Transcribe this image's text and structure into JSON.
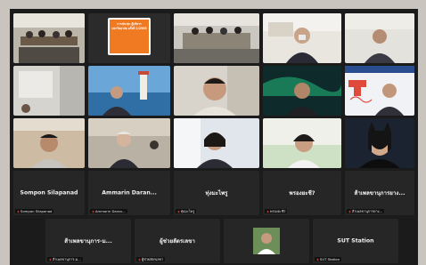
{
  "participants": [
    {
      "id": "r1c1",
      "caption": "",
      "center_name": ""
    },
    {
      "id": "r1c2",
      "caption": "",
      "center_name": "",
      "logo_text": "การประชุม ผู้บริหาร มหาวิทยาลัย ครั้งที่ 2/2565"
    },
    {
      "id": "r1c3",
      "caption": "",
      "center_name": ""
    },
    {
      "id": "r1c4",
      "caption": "",
      "center_name": ""
    },
    {
      "id": "r1c5",
      "caption": "",
      "center_name": ""
    },
    {
      "id": "r2c1",
      "caption": "",
      "center_name": ""
    },
    {
      "id": "r2c2",
      "caption": "",
      "center_name": ""
    },
    {
      "id": "r2c3",
      "caption": "",
      "center_name": ""
    },
    {
      "id": "r2c4",
      "caption": "",
      "center_name": ""
    },
    {
      "id": "r2c5",
      "caption": "",
      "center_name": ""
    },
    {
      "id": "r3c1",
      "caption": "",
      "center_name": ""
    },
    {
      "id": "r3c2",
      "caption": "",
      "center_name": ""
    },
    {
      "id": "r3c3",
      "caption": "",
      "center_name": ""
    },
    {
      "id": "r3c4",
      "caption": "",
      "center_name": ""
    },
    {
      "id": "r3c5",
      "caption": "",
      "center_name": ""
    },
    {
      "id": "r4c1",
      "caption": "Sompon Silapanad",
      "center_name": "Sompon Silapanad"
    },
    {
      "id": "r4c2",
      "caption": "Ammarin Daran...",
      "center_name": "Ammarin Daran..."
    },
    {
      "id": "r4c3",
      "caption": "ทุ่งมะไพรู",
      "center_name": "ทุ่งมะไพรู"
    },
    {
      "id": "r4c4",
      "caption": "พรองยะชี?",
      "center_name": "พรองยะชี?"
    },
    {
      "id": "r4c5",
      "caption": "ส้าเพลขานุการยาง...",
      "center_name": "ส้าเพลขานุการยาง..."
    },
    {
      "id": "r5c1",
      "caption": "ส้าเพลขานุการ-ม...",
      "center_name": "ส้าเพลขานุการ-ม..."
    },
    {
      "id": "r5c2",
      "caption": "ผู้ช่วยลัตรเลขา",
      "center_name": "ผู้ช่วยลัตรเลขา"
    },
    {
      "id": "r5c3",
      "caption": "",
      "center_name": ""
    },
    {
      "id": "r5c4",
      "caption": "SUT Station",
      "center_name": "SUT Station"
    }
  ]
}
